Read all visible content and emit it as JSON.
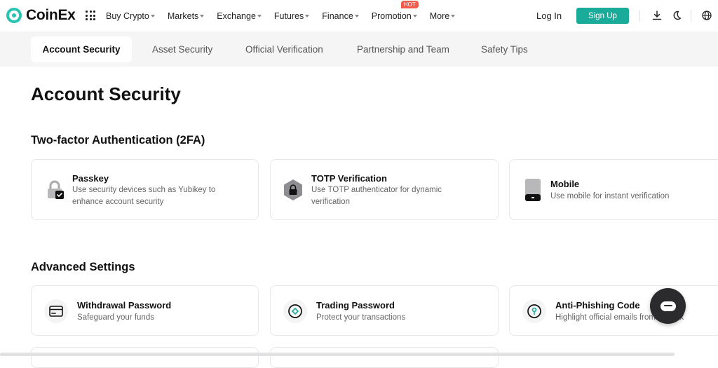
{
  "header": {
    "brand": "CoinEx",
    "nav": [
      {
        "label": "Buy Crypto"
      },
      {
        "label": "Markets"
      },
      {
        "label": "Exchange"
      },
      {
        "label": "Futures"
      },
      {
        "label": "Finance"
      },
      {
        "label": "Promotion",
        "badge": "HOT"
      },
      {
        "label": "More"
      }
    ],
    "login_label": "Log In",
    "signup_label": "Sign Up",
    "accent": "#1aab9b"
  },
  "tabs": [
    {
      "label": "Account Security"
    },
    {
      "label": "Asset Security"
    },
    {
      "label": "Official Verification"
    },
    {
      "label": "Partnership and Team"
    },
    {
      "label": "Safety Tips"
    }
  ],
  "page_title": "Account Security",
  "two_fa": {
    "title": "Two-factor Authentication (2FA)",
    "cards": [
      {
        "title": "Passkey",
        "desc": "Use security devices such as Yubikey to enhance account security",
        "icon": "lock-check-icon"
      },
      {
        "title": "TOTP Verification",
        "desc": "Use TOTP authenticator for dynamic verification",
        "icon": "hexagon-lock-icon"
      },
      {
        "title": "Mobile",
        "desc": "Use mobile for instant verification",
        "icon": "mobile-phone-icon"
      }
    ]
  },
  "advanced": {
    "title": "Advanced Settings",
    "cards": [
      {
        "title": "Withdrawal Password",
        "desc": "Safeguard your funds",
        "icon": "card-icon"
      },
      {
        "title": "Trading Password",
        "desc": "Protect your transactions",
        "icon": "diamond-circle-icon"
      },
      {
        "title": "Anti-Phishing Code",
        "desc": "Highlight official emails from CoinEx",
        "icon": "keyhole-icon"
      }
    ]
  }
}
